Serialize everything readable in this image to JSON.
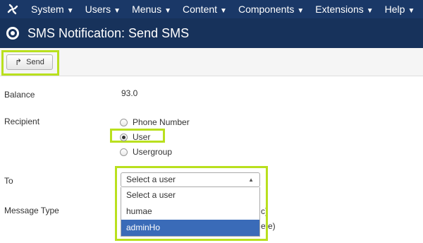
{
  "menu": {
    "items": [
      {
        "label": "System"
      },
      {
        "label": "Users"
      },
      {
        "label": "Menus"
      },
      {
        "label": "Content"
      },
      {
        "label": "Components"
      },
      {
        "label": "Extensions"
      },
      {
        "label": "Help"
      }
    ]
  },
  "header": {
    "title": "SMS Notification: Send SMS"
  },
  "toolbar": {
    "send_label": "Send"
  },
  "form": {
    "balance_label": "Balance",
    "balance_value": "93.0",
    "recipient_label": "Recipient",
    "recipient_options": [
      "Phone Number",
      "User",
      "Usergroup"
    ],
    "recipient_selected": "User",
    "to_label": "To",
    "to_selected": "Select a user",
    "to_options": [
      "Select a user",
      "humae",
      "adminHo"
    ],
    "to_highlighted": "adminHo",
    "message_type_label": "Message Type",
    "message_type_partial": [
      "c)",
      "ete)"
    ]
  },
  "colors": {
    "topbar": "#1a3867",
    "titlebar": "#17325b",
    "highlight": "#b9e01e",
    "option_active": "#3a6bb8"
  }
}
